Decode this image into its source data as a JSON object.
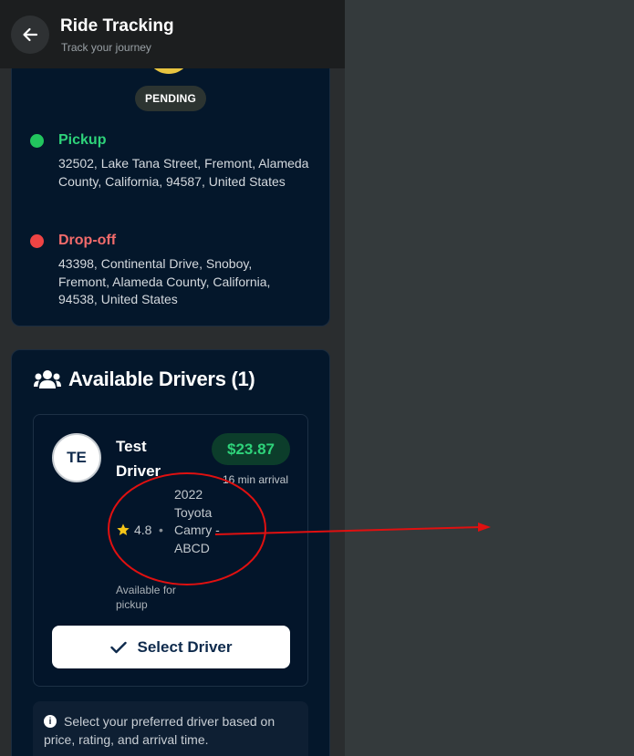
{
  "header": {
    "title": "Ride Tracking",
    "subtitle": "Track your journey",
    "back_icon": "arrow-left-icon"
  },
  "ride": {
    "status": "PENDING",
    "pickup": {
      "label": "Pickup",
      "address": "32502, Lake Tana Street, Fremont, Alameda County, California, 94587, United States",
      "color": "#22c55e"
    },
    "dropoff": {
      "label": "Drop-off",
      "address": "43398, Continental Drive, Snoboy, Fremont, Alameda County, California, 94538, United States",
      "color": "#ef4444"
    }
  },
  "drivers": {
    "title": "Available Drivers (1)",
    "icon": "users-icon",
    "list": [
      {
        "initials": "TE",
        "name": "Test Driver",
        "price": "$23.87",
        "eta": "16 min arrival",
        "rating": "4.8",
        "separator": "•",
        "vehicle": "2022 Toyota Camry - ABCD",
        "availability": "Available for pickup",
        "select_label": "Select Driver"
      }
    ],
    "tip": "Select your preferred driver based on price, rating, and arrival time."
  },
  "colors": {
    "accent_green": "#2ed37a",
    "annotation_red": "#e01010",
    "star": "#f5c518"
  }
}
